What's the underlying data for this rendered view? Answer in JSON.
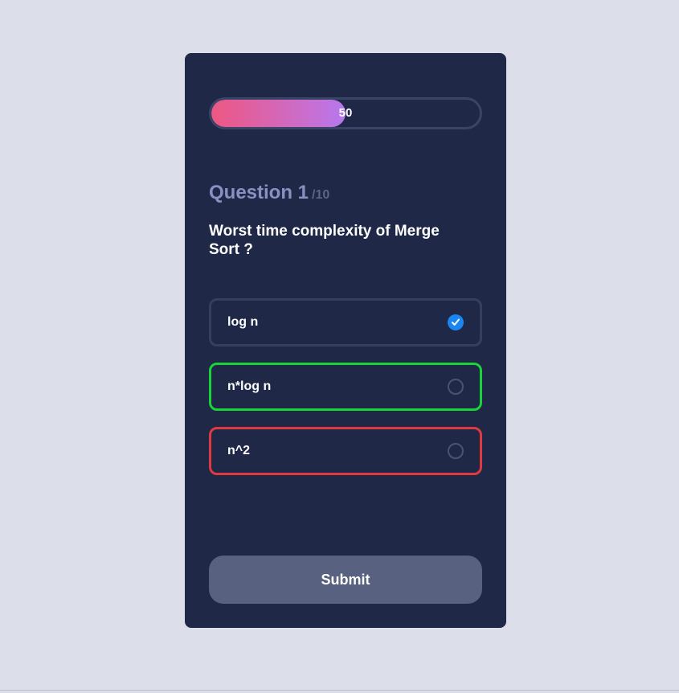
{
  "progress": {
    "value": 50,
    "label": "50"
  },
  "question": {
    "title": "Question 1",
    "total": "/10",
    "text": "Worst time complexity of Merge Sort ?"
  },
  "options": [
    {
      "label": "log n",
      "checked": true,
      "state": "neutral"
    },
    {
      "label": "n*log n",
      "checked": false,
      "state": "correct"
    },
    {
      "label": "n^2",
      "checked": false,
      "state": "wrong"
    }
  ],
  "submit": {
    "label": "Submit"
  },
  "colors": {
    "background": "#dcdfea",
    "card": "#1f2847",
    "correct": "#18d437",
    "wrong": "#e03a41",
    "radio_checked": "#1a86f2",
    "progress_start": "#ee5782",
    "progress_end": "#b578ee",
    "submit": "#58617f"
  }
}
